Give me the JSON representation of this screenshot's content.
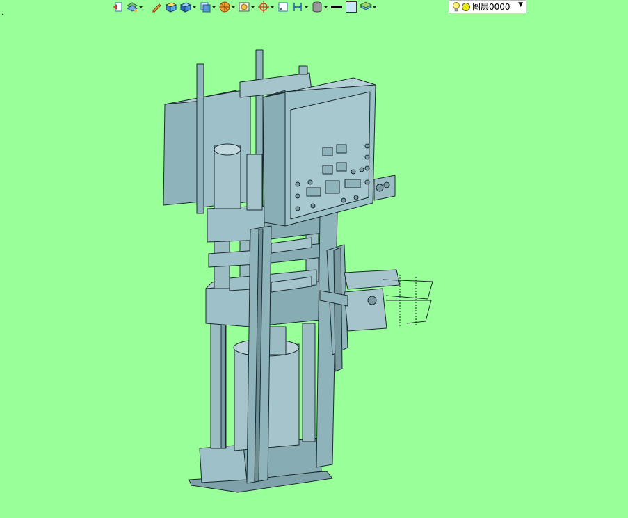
{
  "toolbar": {
    "items": [
      {
        "icon": "undo-view-icon",
        "dropdown": false
      },
      {
        "icon": "layer-stack-icon",
        "dropdown": true
      },
      {
        "icon": "pencil-icon",
        "dropdown": false
      },
      {
        "icon": "solid-box-yellow-icon",
        "dropdown": false
      },
      {
        "icon": "solid-box-blue-icon",
        "dropdown": true
      },
      {
        "icon": "view-cube-icon",
        "dropdown": true
      },
      {
        "icon": "render-ball-icon",
        "dropdown": true
      },
      {
        "icon": "section-view-icon",
        "dropdown": true
      },
      {
        "icon": "snap-target-icon",
        "dropdown": true
      },
      {
        "icon": "small-frame-icon",
        "dropdown": false
      },
      {
        "icon": "dimension-icon",
        "dropdown": true
      },
      {
        "icon": "cylinder-icon",
        "dropdown": true
      },
      {
        "icon": "line-weight-icon",
        "dropdown": false
      },
      {
        "icon": "color-swatch-icon",
        "dropdown": false
      },
      {
        "icon": "layers-icon",
        "dropdown": true
      }
    ],
    "layer_select": {
      "value": "图层0000",
      "colors": {
        "bulb": "#fff27a",
        "circle": "#e8e800"
      }
    }
  },
  "colors": {
    "background": "#99ff99",
    "model_fill": "#8fb3bb",
    "model_stroke": "#1a2a2e"
  }
}
